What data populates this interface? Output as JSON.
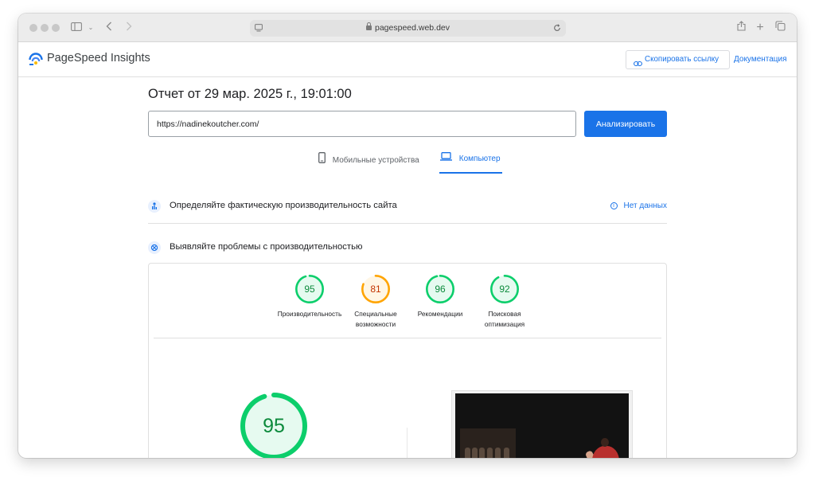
{
  "browser": {
    "url": "pagespeed.web.dev",
    "icons": [
      "sidebar-icon",
      "chevron-down-icon",
      "back-icon",
      "forward-icon",
      "page-icon",
      "lock-icon",
      "reload-icon",
      "share-icon",
      "new-tab-icon",
      "tabs-icon"
    ]
  },
  "header": {
    "brand": "PageSpeed Insights",
    "copy_link_label": "Скопировать ссылку",
    "docs_label": "Документация"
  },
  "report": {
    "title": "Отчет от 29 мар. 2025 г., 19:01:00",
    "url_value": "https://nadinekoutcher.com/",
    "analyze_label": "Анализировать"
  },
  "tabs": {
    "mobile": "Мобильные устройства",
    "desktop": "Компьютер",
    "active": "desktop"
  },
  "sections": {
    "field": {
      "title": "Определяйте фактическую производительность сайта",
      "status": "Нет данных"
    },
    "lab": {
      "title": "Выявляйте проблемы с производительностью"
    }
  },
  "scores": [
    {
      "value": 95,
      "label": "Производительность",
      "color": "#0cce6b"
    },
    {
      "value": 81,
      "label": "Специальные возможности",
      "color": "#ffa400"
    },
    {
      "value": 96,
      "label": "Рекомендации",
      "color": "#0cce6b"
    },
    {
      "value": 92,
      "label": "Поисковая оптимизация",
      "color": "#0cce6b"
    }
  ],
  "big_score": {
    "value": 95,
    "color": "#0cce6b"
  },
  "colors": {
    "accent": "#1a73e8",
    "good": "#0cce6b",
    "average": "#ffa400"
  }
}
